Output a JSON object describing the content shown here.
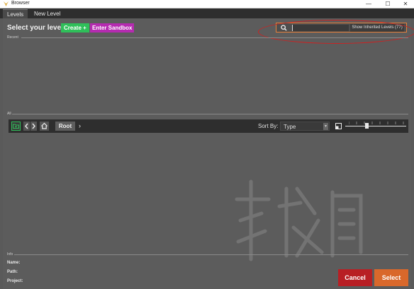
{
  "window": {
    "title": "Browser",
    "minimize": "—",
    "maximize": "☐",
    "close": "✕"
  },
  "tabs": [
    {
      "label": "Levels",
      "active": true
    },
    {
      "label": "New Level",
      "active": false
    }
  ],
  "header": {
    "heading": "Select your level",
    "create_label": "Create +",
    "sandbox_label": "Enter Sandbox",
    "search_value": "",
    "inherited_label": "Show Inherited Levels (77)"
  },
  "sections": {
    "recent": "Recent",
    "all": "All",
    "info": "Info"
  },
  "toolbar": {
    "root_label": "Root",
    "sort_by_label": "Sort By:",
    "sort_value": "Type",
    "thumbnail_size_level": 0.35
  },
  "info": {
    "name_label": "Name:",
    "path_label": "Path:",
    "project_label": "Project:"
  },
  "actions": {
    "cancel_label": "Cancel",
    "select_label": "Select"
  },
  "colors": {
    "create": "#2fbf5a",
    "sandbox": "#b52bb0",
    "cancel": "#b81f24",
    "select": "#d9682b",
    "search_highlight": "#e8803a",
    "annotation": "#d02020"
  }
}
